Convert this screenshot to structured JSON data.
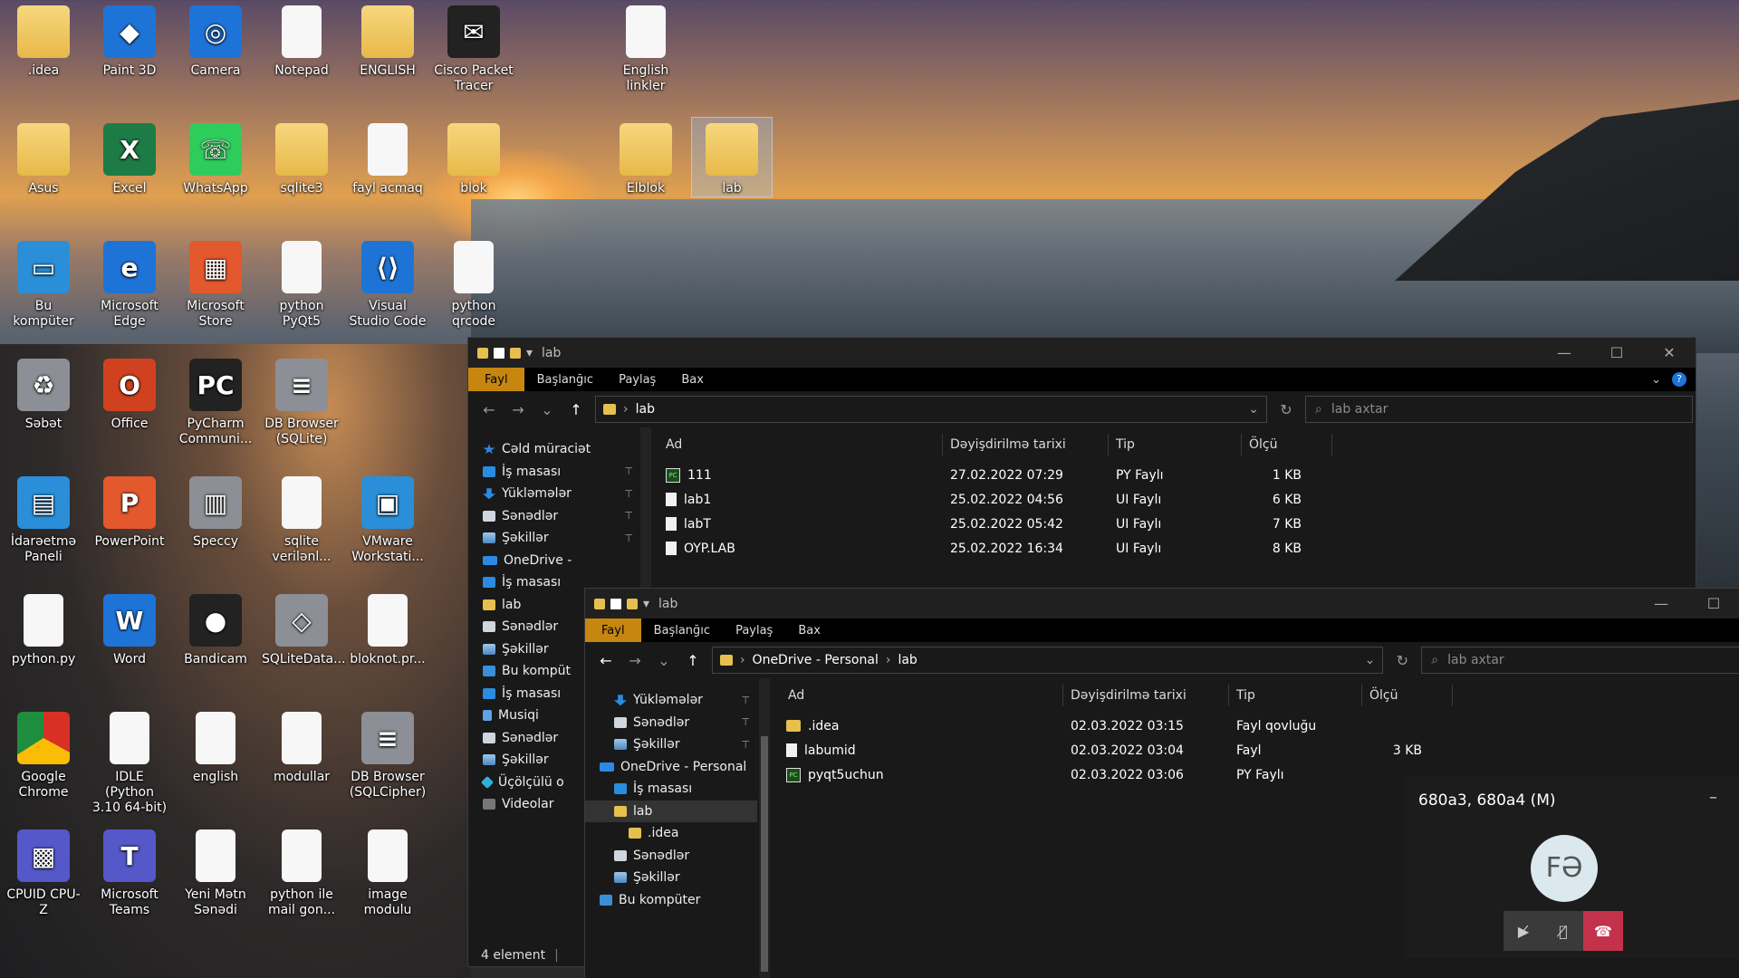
{
  "desktop": {
    "icons": [
      {
        "label": ".idea",
        "glyph": "",
        "kind": "folder"
      },
      {
        "label": "Paint 3D",
        "glyph": "◆",
        "kind": "blue"
      },
      {
        "label": "Camera",
        "glyph": "◎",
        "kind": "blue"
      },
      {
        "label": "Notepad",
        "glyph": "",
        "kind": "doc"
      },
      {
        "label": "ENGLISH",
        "glyph": "",
        "kind": "folder"
      },
      {
        "label": "Cisco Packet Tracer",
        "glyph": "✉",
        "kind": "dark"
      },
      {
        "label": "English linkler",
        "glyph": "",
        "kind": "doc"
      },
      {
        "label": "Asus",
        "glyph": "",
        "kind": "folder"
      },
      {
        "label": "Excel",
        "glyph": "X",
        "kind": "green"
      },
      {
        "label": "WhatsApp",
        "glyph": "☏",
        "kind": "wa"
      },
      {
        "label": "sqlite3",
        "glyph": "",
        "kind": "folder"
      },
      {
        "label": "fayl acmaq",
        "glyph": "",
        "kind": "doc"
      },
      {
        "label": "blok",
        "glyph": "",
        "kind": "folder"
      },
      {
        "label": "Elblok",
        "glyph": "",
        "kind": "folder"
      },
      {
        "label": "lab",
        "glyph": "",
        "kind": "folder"
      },
      {
        "label": "Bu kompüter",
        "glyph": "▭",
        "kind": "cyan"
      },
      {
        "label": "Microsoft Edge",
        "glyph": "e",
        "kind": "blue"
      },
      {
        "label": "Microsoft Store",
        "glyph": "▦",
        "kind": "orange"
      },
      {
        "label": "python PyQt5",
        "glyph": "",
        "kind": "doc"
      },
      {
        "label": "Visual Studio Code",
        "glyph": "⟨⟩",
        "kind": "blue"
      },
      {
        "label": "python qrcode",
        "glyph": "",
        "kind": "doc"
      },
      {
        "label": "Səbət",
        "glyph": "♻",
        "kind": "gray"
      },
      {
        "label": "Office",
        "glyph": "O",
        "kind": "red"
      },
      {
        "label": "PyCharm Communi...",
        "glyph": "PC",
        "kind": "dark"
      },
      {
        "label": "DB Browser (SQLite)",
        "glyph": "≡",
        "kind": "gray"
      },
      {
        "label": "İdarəetmə Paneli",
        "glyph": "▤",
        "kind": "cyan"
      },
      {
        "label": "PowerPoint",
        "glyph": "P",
        "kind": "orange"
      },
      {
        "label": "Speccy",
        "glyph": "▥",
        "kind": "gray"
      },
      {
        "label": "sqlite verilənl...",
        "glyph": "",
        "kind": "doc"
      },
      {
        "label": "VMware Workstati...",
        "glyph": "▣",
        "kind": "cyan"
      },
      {
        "label": "python.py",
        "glyph": "",
        "kind": "doc"
      },
      {
        "label": "Word",
        "glyph": "W",
        "kind": "blue"
      },
      {
        "label": "Bandicam",
        "glyph": "●",
        "kind": "dark"
      },
      {
        "label": "SQLiteData...",
        "glyph": "◇",
        "kind": "gray"
      },
      {
        "label": "bloknot.pr...",
        "glyph": "",
        "kind": "doc"
      },
      {
        "label": "Google Chrome",
        "glyph": "",
        "kind": "chrome"
      },
      {
        "label": "IDLE (Python 3.10 64-bit)",
        "glyph": "",
        "kind": "doc"
      },
      {
        "label": "english",
        "glyph": "",
        "kind": "doc"
      },
      {
        "label": "modullar",
        "glyph": "",
        "kind": "doc"
      },
      {
        "label": "DB Browser (SQLCipher)",
        "glyph": "≡",
        "kind": "gray"
      },
      {
        "label": "CPUID CPU-Z",
        "glyph": "▩",
        "kind": "purple"
      },
      {
        "label": "Microsoft Teams",
        "glyph": "T",
        "kind": "purple"
      },
      {
        "label": "Yeni Mətn Sənədi",
        "glyph": "",
        "kind": "doc"
      },
      {
        "label": "python ile mail gon...",
        "glyph": "",
        "kind": "doc"
      },
      {
        "label": "image modulu",
        "glyph": "",
        "kind": "doc"
      }
    ]
  },
  "explorer1": {
    "title": "lab",
    "ribbon_tabs": [
      "Fayl",
      "Başlanğıc",
      "Paylaş",
      "Bax"
    ],
    "address": "lab",
    "search_placeholder": "lab axtar",
    "nav": [
      {
        "label": "Cəld müraciət",
        "icon": "star"
      },
      {
        "label": "İş masası",
        "icon": "desk",
        "pin": "📌"
      },
      {
        "label": "Yükləmələr",
        "icon": "dl",
        "pin": "📌"
      },
      {
        "label": "Sənədlər",
        "icon": "doc",
        "pin": "📌"
      },
      {
        "label": "Şəkillər",
        "icon": "pic",
        "pin": "📌"
      },
      {
        "label": "OneDrive -",
        "icon": "cloud"
      },
      {
        "label": "İş masası",
        "icon": "desk"
      },
      {
        "label": "lab",
        "icon": "folder"
      },
      {
        "label": "Sənədlər",
        "icon": "doc"
      },
      {
        "label": "Şəkillər",
        "icon": "pic"
      },
      {
        "label": "Bu kompüt",
        "icon": "pc"
      },
      {
        "label": "İş masası",
        "icon": "desk"
      },
      {
        "label": "Musiqi",
        "icon": "music"
      },
      {
        "label": "Sənədlər",
        "icon": "doc"
      },
      {
        "label": "Şəkillər",
        "icon": "pic"
      },
      {
        "label": "Üçölçülü o",
        "icon": "3d"
      },
      {
        "label": "Videolar",
        "icon": "vid"
      }
    ],
    "columns": [
      "Ad",
      "Dəyişdirilmə tarixi",
      "Tip",
      "Ölçü"
    ],
    "files": [
      {
        "name": "111",
        "date": "27.02.2022 07:29",
        "type": "PY Faylı",
        "size": "1 KB",
        "icon": "py"
      },
      {
        "name": "lab1",
        "date": "25.02.2022 04:56",
        "type": "UI Faylı",
        "size": "6 KB",
        "icon": "file"
      },
      {
        "name": "labT",
        "date": "25.02.2022 05:42",
        "type": "UI Faylı",
        "size": "7 KB",
        "icon": "file"
      },
      {
        "name": "OYP.LAB",
        "date": "25.02.2022 16:34",
        "type": "UI Faylı",
        "size": "8 KB",
        "icon": "file"
      }
    ],
    "status": "4 element"
  },
  "explorer2": {
    "title": "lab",
    "ribbon_tabs": [
      "Fayl",
      "Başlanğıc",
      "Paylaş",
      "Bax"
    ],
    "breadcrumb": [
      "OneDrive - Personal",
      "lab"
    ],
    "search_placeholder": "lab axtar",
    "nav": [
      {
        "label": "Yükləmələr",
        "icon": "dl",
        "pin": "📌",
        "indent": 1
      },
      {
        "label": "Sənədlər",
        "icon": "doc",
        "pin": "📌",
        "indent": 1
      },
      {
        "label": "Şəkillər",
        "icon": "pic",
        "pin": "📌",
        "indent": 1
      },
      {
        "label": "OneDrive - Personal",
        "icon": "cloud",
        "indent": 0
      },
      {
        "label": "İş masası",
        "icon": "desk",
        "indent": 1
      },
      {
        "label": "lab",
        "icon": "folder",
        "indent": 1,
        "selected": true
      },
      {
        "label": ".idea",
        "icon": "folder",
        "indent": 2
      },
      {
        "label": "Sənədlər",
        "icon": "doc",
        "indent": 1
      },
      {
        "label": "Şəkillər",
        "icon": "pic",
        "indent": 1
      },
      {
        "label": "Bu kompüter",
        "icon": "pc",
        "indent": 0
      }
    ],
    "columns": [
      "Ad",
      "Dəyişdirilmə tarixi",
      "Tip",
      "Ölçü"
    ],
    "files": [
      {
        "name": ".idea",
        "date": "02.03.2022 03:15",
        "type": "Fayl qovluğu",
        "size": "",
        "icon": "folder"
      },
      {
        "name": "labumid",
        "date": "02.03.2022 03:04",
        "type": "Fayl",
        "size": "3 KB",
        "icon": "file"
      },
      {
        "name": "pyqt5uchun",
        "date": "02.03.2022 03:06",
        "type": "PY Faylı",
        "size": "",
        "icon": "py"
      }
    ]
  },
  "call": {
    "title": "680a3, 680a4 (M)",
    "avatar_initials": "FƏ",
    "buttons": [
      "camera-off",
      "mic-off",
      "hang-up"
    ]
  }
}
